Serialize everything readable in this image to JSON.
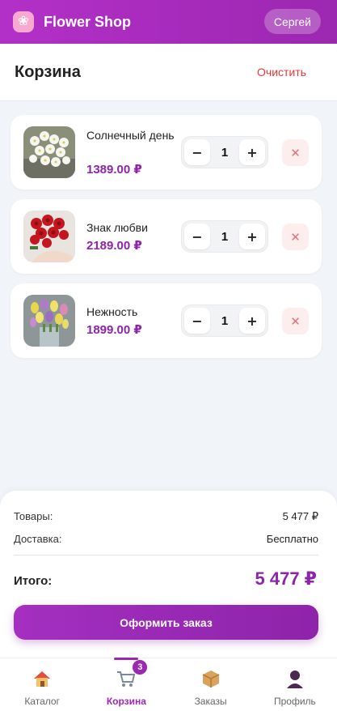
{
  "header": {
    "logo_icon": "flower-icon",
    "title": "Flower Shop",
    "user": "Сергей",
    "brand_color": "#9c27b0"
  },
  "page": {
    "title": "Корзина",
    "clear_label": "Очистить"
  },
  "cart": {
    "items": [
      {
        "name": "Солнечный день",
        "price": "1389.00 ₽",
        "qty": "1",
        "image": "white-daisy-bouquet",
        "minus": "−",
        "plus": "+",
        "remove": "✕"
      },
      {
        "name": "Знак любви",
        "price": "2189.00 ₽",
        "qty": "1",
        "image": "red-rose-bouquet",
        "minus": "−",
        "plus": "+",
        "remove": "✕"
      },
      {
        "name": "Нежность",
        "price": "1899.00 ₽",
        "qty": "1",
        "image": "tulip-bouquet",
        "minus": "−",
        "plus": "+",
        "remove": "✕"
      }
    ]
  },
  "summary": {
    "goods_label": "Товары:",
    "goods_value": "5 477 ₽",
    "delivery_label": "Доставка:",
    "delivery_value": "Бесплатно",
    "total_label": "Итого:",
    "total_value": "5 477 ₽",
    "checkout_label": "Оформить заказ"
  },
  "nav": {
    "items": [
      {
        "label": "Каталог",
        "icon": "home-icon"
      },
      {
        "label": "Корзина",
        "icon": "cart-icon",
        "badge": "3",
        "active": true
      },
      {
        "label": "Заказы",
        "icon": "package-icon"
      },
      {
        "label": "Профиль",
        "icon": "user-icon"
      }
    ]
  }
}
